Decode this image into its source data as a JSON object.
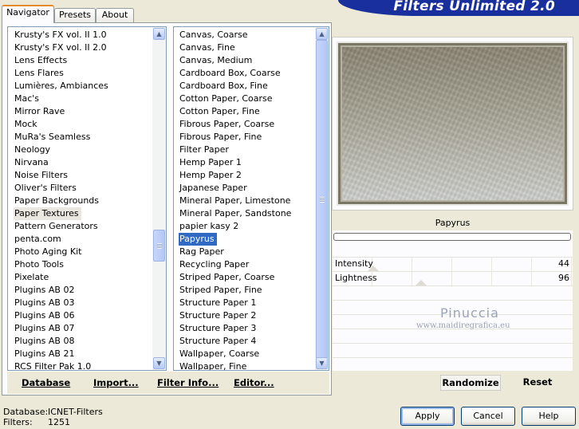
{
  "window": {
    "title": "Filters Unlimited 2.0"
  },
  "tabs": [
    {
      "label": "Navigator",
      "active": true
    },
    {
      "label": "Presets",
      "active": false
    },
    {
      "label": "About",
      "active": false
    }
  ],
  "categories": {
    "selected": "Paper Textures",
    "items": [
      "Krusty's FX vol. II 1.0",
      "Krusty's FX vol. II 2.0",
      "Lens Effects",
      "Lens Flares",
      "Lumières, Ambiances",
      "Mac's",
      "Mirror Rave",
      "Mock",
      "MuRa's Seamless",
      "Neology",
      "Nirvana",
      "Noise Filters",
      "Oliver's Filters",
      "Paper Backgrounds",
      "Paper Textures",
      "Pattern Generators",
      "penta.com",
      "Photo Aging Kit",
      "Photo Tools",
      "Pixelate",
      "Plugins AB 02",
      "Plugins AB 03",
      "Plugins AB 06",
      "Plugins AB 07",
      "Plugins AB 08",
      "Plugins AB 21",
      "RCS Filter Pak 1.0"
    ]
  },
  "filters": {
    "selected": "Papyrus",
    "items": [
      "Canvas, Coarse",
      "Canvas, Fine",
      "Canvas, Medium",
      "Cardboard Box, Coarse",
      "Cardboard Box, Fine",
      "Cotton Paper, Coarse",
      "Cotton Paper, Fine",
      "Fibrous Paper, Coarse",
      "Fibrous Paper, Fine",
      "Filter Paper",
      "Hemp Paper 1",
      "Hemp Paper 2",
      "Japanese Paper",
      "Mineral Paper, Limestone",
      "Mineral Paper, Sandstone",
      "papier kasy 2",
      "Papyrus",
      "Rag Paper",
      "Recycling Paper",
      "Striped Paper, Coarse",
      "Striped Paper, Fine",
      "Structure Paper 1",
      "Structure Paper 2",
      "Structure Paper 3",
      "Structure Paper 4",
      "Wallpaper, Coarse",
      "Wallpaper, Fine"
    ]
  },
  "toolbar": {
    "database": "Database",
    "import": "Import...",
    "filter_info": "Filter Info...",
    "editor": "Editor..."
  },
  "filter_panel": {
    "name": "Papyrus",
    "params": [
      {
        "name": "Intensity",
        "value": 44
      },
      {
        "name": "Lightness",
        "value": 96
      }
    ],
    "randomize": "Randomize",
    "reset": "Reset"
  },
  "watermark": {
    "line1": "Pinuccia",
    "line2": "www.maidiregrafica.eu"
  },
  "status": {
    "database_label": "Database:",
    "database_value": "ICNET-Filters",
    "filters_label": "Filters:",
    "filters_value": "1251"
  },
  "dialog": {
    "apply": "Apply",
    "cancel": "Cancel",
    "help": "Help"
  }
}
